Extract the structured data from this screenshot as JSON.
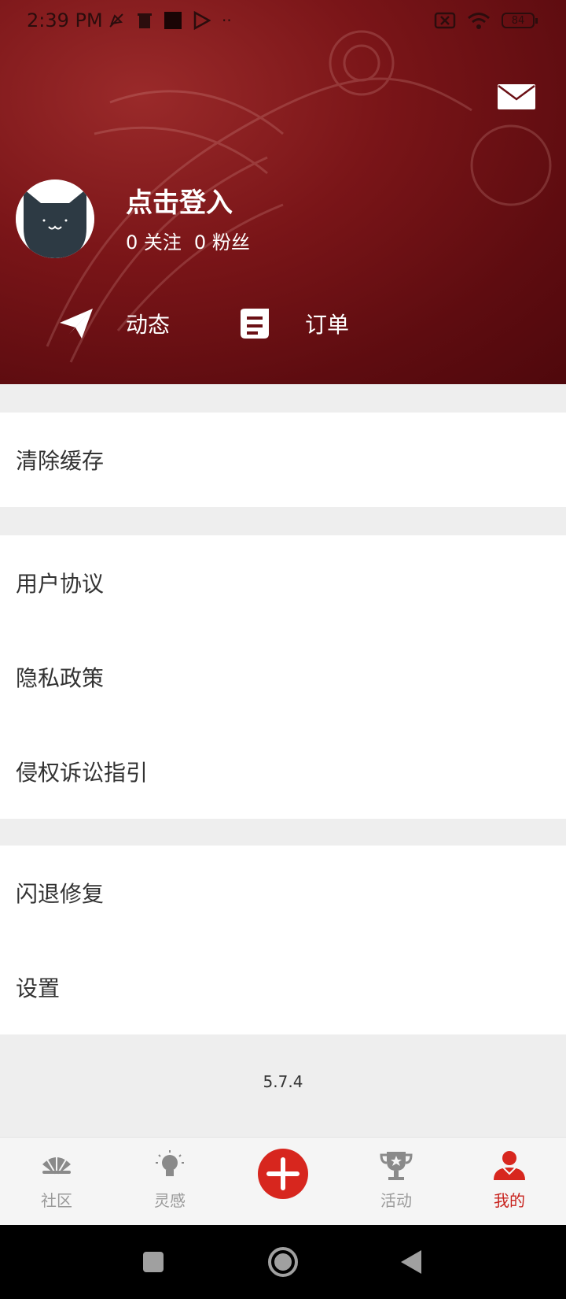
{
  "status_bar": {
    "time": "2:39 PM",
    "battery": "84"
  },
  "profile": {
    "login_text": "点击登入",
    "follow_count": "0",
    "follow_label": "关注",
    "fans_count": "0",
    "fans_label": "粉丝"
  },
  "quick_actions": [
    {
      "label": "动态",
      "icon": "paper-plane-icon"
    },
    {
      "label": "订单",
      "icon": "order-scroll-icon"
    }
  ],
  "menu": {
    "group1": [
      "清除缓存"
    ],
    "group2": [
      "用户协议",
      "隐私政策",
      "侵权诉讼指引"
    ],
    "group3": [
      "闪退修复",
      "设置"
    ]
  },
  "version": "5.7.4",
  "tabs": [
    {
      "label": "社区",
      "icon": "fan-icon"
    },
    {
      "label": "灵感",
      "icon": "lightbulb-icon"
    },
    {
      "label": "",
      "icon": "plus-icon"
    },
    {
      "label": "活动",
      "icon": "trophy-icon"
    },
    {
      "label": "我的",
      "icon": "person-icon"
    }
  ],
  "colors": {
    "header": "#6a0f14",
    "accent": "#d7261e",
    "active_tab": "#c8231e",
    "inactive_tab": "#9a9a9a"
  }
}
